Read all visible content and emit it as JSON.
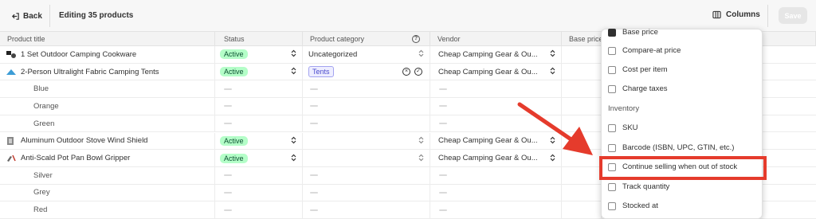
{
  "topbar": {
    "back_label": "Back",
    "title": "Editing 35 products",
    "columns_label": "Columns",
    "save_label": "Save"
  },
  "columns": {
    "title": "Product title",
    "status": "Status",
    "category": "Product category",
    "vendor": "Vendor",
    "base_price": "Base price"
  },
  "rows": [
    {
      "title": "1 Set Outdoor Camping Cookware",
      "status": "Active",
      "category": "Uncategorized",
      "vendor": "Cheap Camping Gear & Ou..."
    },
    {
      "title": "2-Person Ultralight Fabric Camping Tents",
      "status": "Active",
      "category_tag": "Tents",
      "vendor": "Cheap Camping Gear & Ou..."
    },
    {
      "variant": "Blue"
    },
    {
      "variant": "Orange"
    },
    {
      "variant": "Green"
    },
    {
      "title": "Aluminum Outdoor Stove Wind Shield",
      "status": "Active",
      "category": "",
      "vendor": "Cheap Camping Gear & Ou..."
    },
    {
      "title": "Anti-Scald Pot Pan Bowl Gripper",
      "status": "Active",
      "category": "",
      "vendor": "Cheap Camping Gear & Ou..."
    },
    {
      "variant": "Silver"
    },
    {
      "variant": "Grey"
    },
    {
      "variant": "Red"
    }
  ],
  "panel": {
    "items_top": [
      "Base price",
      "Compare-at price",
      "Cost per item",
      "Charge taxes"
    ],
    "inventory_label": "Inventory",
    "items_inventory": [
      "SKU",
      "Barcode (ISBN, UPC, GTIN, etc.)",
      "Continue selling when out of stock",
      "Track quantity",
      "Stocked at"
    ]
  },
  "colors": {
    "annotation": "#e53b2c",
    "status_active": "#b4fec8"
  }
}
